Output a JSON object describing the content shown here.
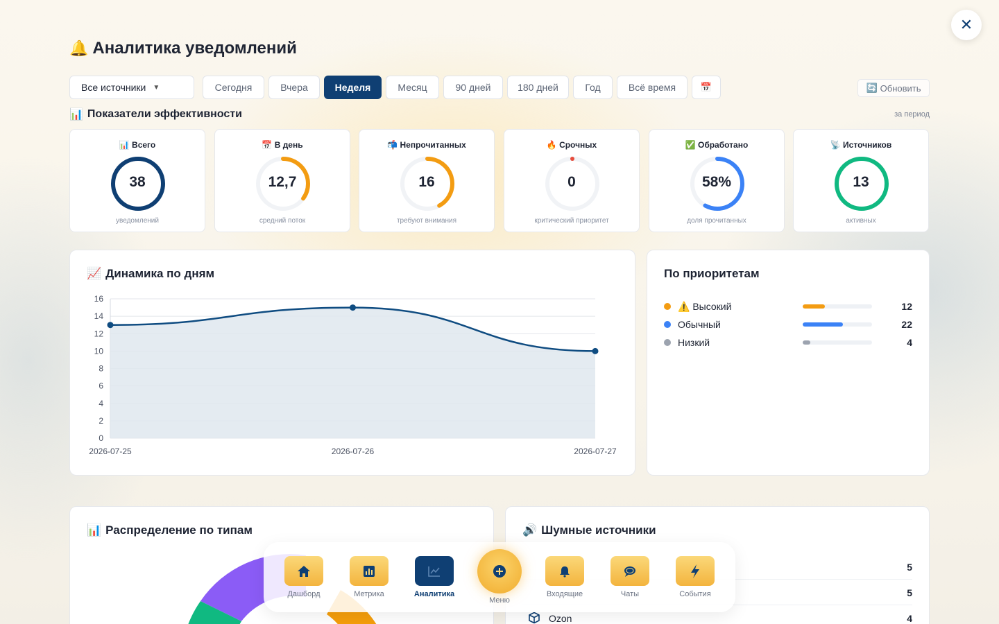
{
  "header": {
    "icon": "bell-icon",
    "title": "Аналитика уведомлений",
    "close_label": "✕"
  },
  "filters": {
    "source_select": "Все источники",
    "periods": [
      "Сегодня",
      "Вчера",
      "Неделя",
      "Месяц",
      "90 дней",
      "180 дней",
      "Год",
      "Всё время"
    ],
    "active_period": "Неделя",
    "calendar_icon": "calendar-icon",
    "refresh_label": "Обновить"
  },
  "kpi_section": {
    "title": "Показатели эффективности",
    "period_note": "за период"
  },
  "kpis": [
    {
      "label": "Всего",
      "icon": "bar-chart-icon",
      "value": "38",
      "sub": "уведомлений",
      "fill": 1.0,
      "color": "#0f3f73"
    },
    {
      "label": "В день",
      "icon": "calendar-icon",
      "value": "12,7",
      "sub": "средний поток",
      "fill": 0.35,
      "color": "#f39c12"
    },
    {
      "label": "Непрочитанных",
      "icon": "mailbox-icon",
      "value": "16",
      "sub": "требуют внимания",
      "fill": 0.42,
      "color": "#f39c12"
    },
    {
      "label": "Срочных",
      "icon": "fire-icon",
      "value": "0",
      "sub": "критический приоритет",
      "fill": 0.0,
      "color": "#e74c3c"
    },
    {
      "label": "Обработано",
      "icon": "check-icon",
      "value": "58%",
      "sub": "доля прочитанных",
      "fill": 0.58,
      "color": "#3b82f6"
    },
    {
      "label": "Источников",
      "icon": "satellite-icon",
      "value": "13",
      "sub": "активных",
      "fill": 1.0,
      "color": "#10b981"
    }
  ],
  "daily": {
    "title": "Динамика по дням",
    "chart_data": {
      "type": "area",
      "x": [
        "2026-07-25",
        "2026-07-26",
        "2026-07-27"
      ],
      "values": [
        13,
        15,
        10
      ],
      "ylim": [
        0,
        16
      ],
      "yticks": [
        "0",
        "2",
        "4",
        "6",
        "8",
        "10",
        "12",
        "14",
        "16"
      ],
      "line_color": "#0f4c81",
      "fill_color": "#dfe7ef",
      "grid": true
    }
  },
  "priorities": {
    "title": "По приоритетам",
    "items": [
      {
        "name": "⚠️ Высокий",
        "count": "12",
        "fraction": 0.32,
        "color": "#f39c12"
      },
      {
        "name": "Обычный",
        "count": "22",
        "fraction": 0.58,
        "color": "#3b82f6"
      },
      {
        "name": "Низкий",
        "count": "4",
        "fraction": 0.11,
        "color": "#9ca3af"
      }
    ]
  },
  "types": {
    "title": "Распределение по типам",
    "segments": [
      {
        "color": "#8b5cf6"
      },
      {
        "color": "#10b981"
      },
      {
        "color": "#f59e0b"
      }
    ]
  },
  "noisy": {
    "title": "Шумные источники",
    "rows": [
      {
        "name": "",
        "count": "5"
      },
      {
        "name": "",
        "count": "5"
      },
      {
        "name": "Ozon",
        "count": "4",
        "icon": "box-icon"
      }
    ]
  },
  "nav": {
    "items": [
      {
        "label": "Дашборд",
        "icon": "home-icon"
      },
      {
        "label": "Метрика",
        "icon": "chart-icon"
      },
      {
        "label": "Аналитика",
        "icon": "trend-icon",
        "active": true
      },
      {
        "label": "Входящие",
        "icon": "bell-icon"
      },
      {
        "label": "Чаты",
        "icon": "chat-icon"
      },
      {
        "label": "События",
        "icon": "lightning-icon"
      }
    ],
    "menu_label": "Меню"
  }
}
